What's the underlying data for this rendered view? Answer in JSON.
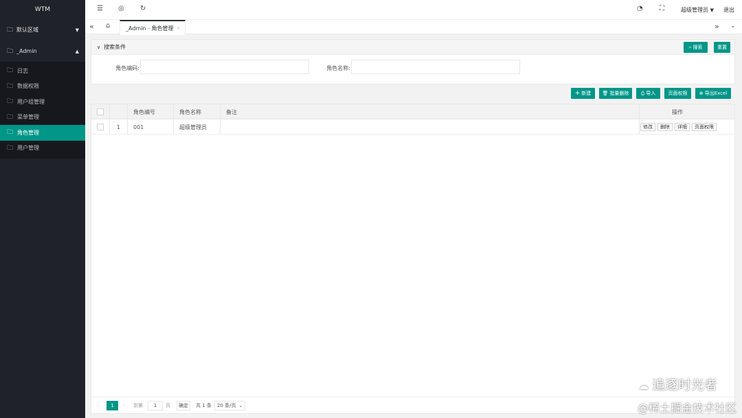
{
  "sidebar": {
    "logo": "WTM",
    "groups": [
      {
        "label": "默认区域",
        "arrow": "▼"
      },
      {
        "label": "_Admin",
        "arrow": "▲"
      }
    ],
    "items": [
      {
        "label": "日志"
      },
      {
        "label": "数据权限"
      },
      {
        "label": "用户组管理"
      },
      {
        "label": "菜单管理"
      },
      {
        "label": "角色管理"
      },
      {
        "label": "用户管理"
      }
    ]
  },
  "topbar": {
    "user": "超级管理员",
    "logout": "退出"
  },
  "tabs": {
    "active_tab": "_Admin - 角色管理",
    "close": "×"
  },
  "search": {
    "title": "搜索条件",
    "search_btn": "搜索",
    "reset_btn": "重置",
    "code_label": "角色编码:",
    "code_value": "",
    "name_label": "角色名称:",
    "name_value": ""
  },
  "toolbar": {
    "new": "新建",
    "batch_delete": "批量删除",
    "import": "导入",
    "page_perm": "页面权限",
    "export": "导出Excel"
  },
  "table": {
    "headers": {
      "code": "角色编号",
      "name": "角色名称",
      "remark": "备注",
      "ops": "操作"
    },
    "rows": [
      {
        "index": "1",
        "code": "001",
        "name": "超级管理员",
        "remark": "",
        "ops": [
          "修改",
          "删除",
          "详细",
          "页面权限"
        ]
      }
    ]
  },
  "pager": {
    "prev": "‹",
    "current": "1",
    "next": "›",
    "goto_label": "到第",
    "goto_value": "1",
    "page_unit": "页",
    "confirm": "确定",
    "total": "共 1 条",
    "page_size": "20 条/页"
  },
  "watermark": {
    "line1": "追逐时光者",
    "line2": "@稀土掘金技术社区"
  },
  "colors": {
    "accent": "#009688",
    "sidebar": "#20222a"
  }
}
